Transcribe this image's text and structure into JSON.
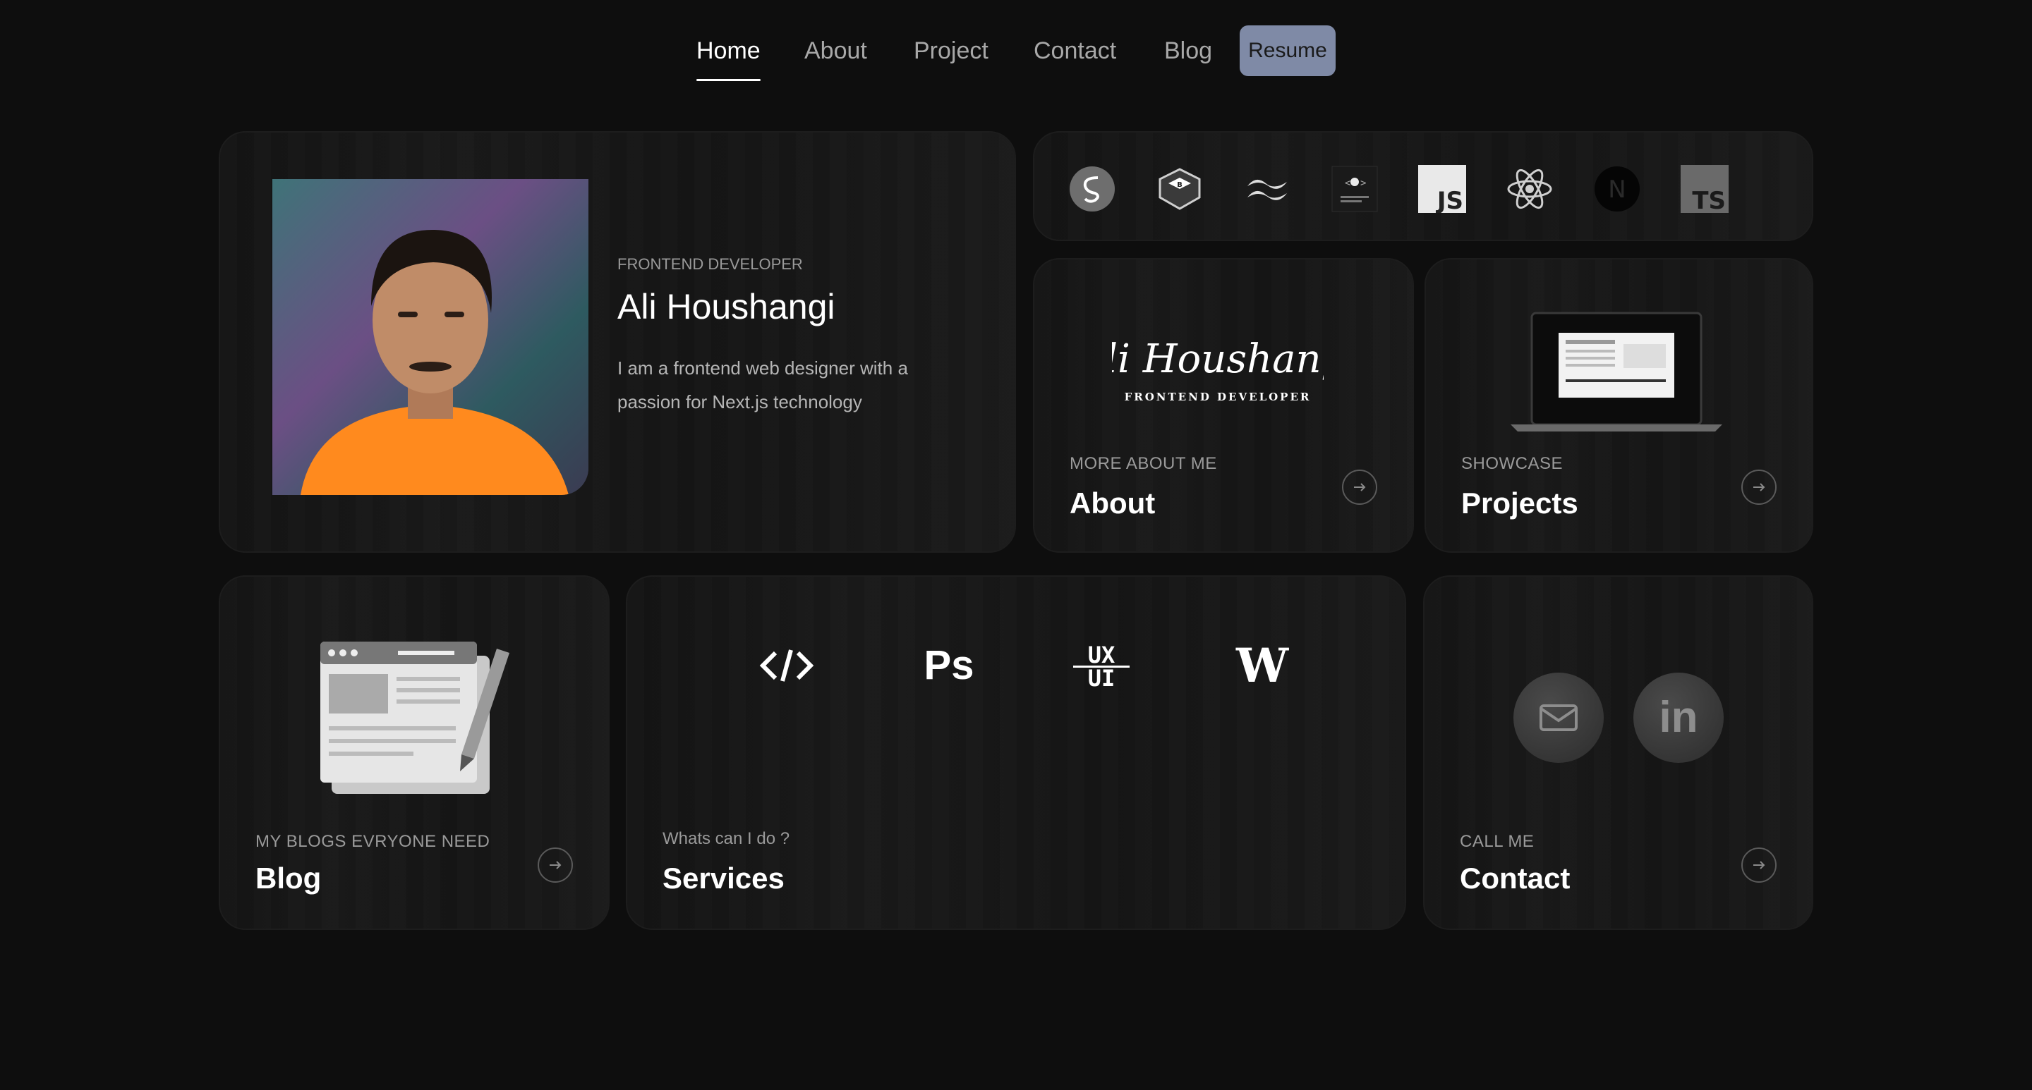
{
  "nav": {
    "links": [
      "Home",
      "About",
      "Project",
      "Contact",
      "Blog"
    ],
    "resume": "Resume"
  },
  "hero": {
    "role": "FRONTEND DEVELOPER",
    "name": "Ali Houshangi",
    "bio": "I am a frontend web designer with a passion for Next.js technology"
  },
  "tech_stack": {
    "icons": [
      "sass-icon",
      "bootstrap-icon",
      "tailwind-icon",
      "styled-components-icon",
      "javascript-icon",
      "react-icon",
      "nextjs-icon",
      "typescript-icon"
    ],
    "js_label": "JS",
    "ts_label": "TS",
    "next_label": "N"
  },
  "about": {
    "signature": "Ali Houshangi",
    "signature_sub": "FRONTEND DEVELOPER",
    "eyebrow": "MORE ABOUT ME",
    "title": "About"
  },
  "projects": {
    "eyebrow": "SHOWCASE",
    "title": "Projects"
  },
  "blog": {
    "eyebrow": "MY BLOGS EVRYONE NEED",
    "title": "Blog"
  },
  "services": {
    "icons": [
      "</>",
      "Ps",
      "UX UI",
      "W"
    ],
    "ps_label": "Ps",
    "ux_label": "UX",
    "ui_label": "UI",
    "w_label": "W",
    "eyebrow": "Whats can I do ?",
    "title": "Services"
  },
  "contact": {
    "linkedin_label": "in",
    "eyebrow": "CALL ME",
    "title": "Contact"
  },
  "colors": {
    "background": "#0e0e0e",
    "resume_button": "#7f8aa6",
    "shirt": "#ff8a1e"
  }
}
